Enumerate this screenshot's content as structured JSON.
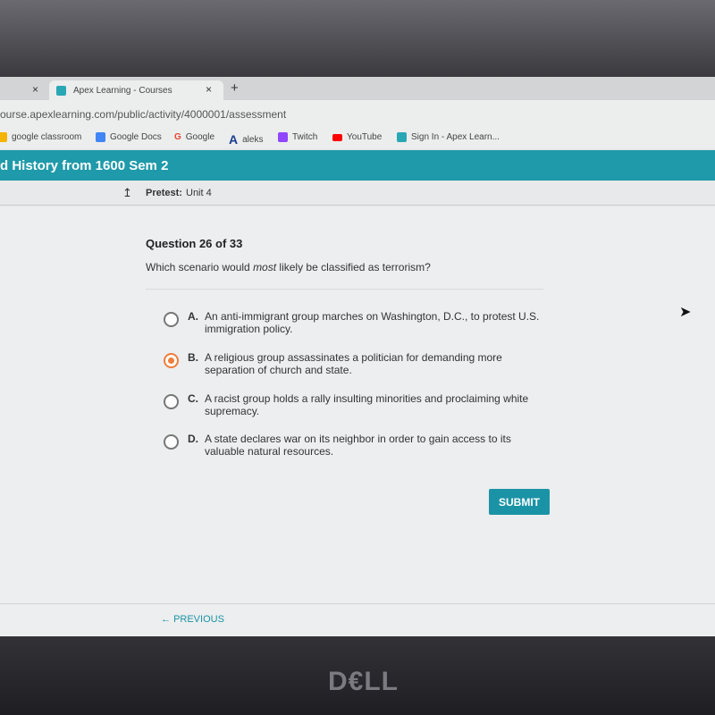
{
  "browser": {
    "tabs": [
      {
        "label": ""
      },
      {
        "label": "Apex Learning - Courses"
      }
    ],
    "new_tab": "+",
    "close": "×",
    "url": "ourse.apexlearning.com/public/activity/4000001/assessment",
    "bookmarks": [
      {
        "label": "google classroom",
        "icon": "classroom-icon",
        "color": "#f4b400"
      },
      {
        "label": "Google Docs",
        "icon": "docs-icon",
        "color": "#4285f4"
      },
      {
        "label": "Google",
        "icon": "google-icon",
        "color": "#ea4335"
      },
      {
        "label": "aleks",
        "icon": "aleks-icon",
        "color": "#1a3d8f"
      },
      {
        "label": "Twitch",
        "icon": "twitch-icon",
        "color": "#9146ff"
      },
      {
        "label": "YouTube",
        "icon": "youtube-icon",
        "color": "#ff0000"
      },
      {
        "label": "Sign In - Apex Learn...",
        "icon": "apex-icon",
        "color": "#2aa7b5"
      }
    ]
  },
  "header": {
    "course": "d History from 1600 Sem 2",
    "color": "#1f9aaa"
  },
  "subheader": {
    "label": "Pretest:",
    "value": "Unit 4"
  },
  "question": {
    "number": "Question 26 of 33",
    "prompt_pre": "Which scenario would ",
    "prompt_em": "most",
    "prompt_post": " likely be classified as terrorism?",
    "options": [
      {
        "letter": "A.",
        "text": "An anti-immigrant group marches on Washington, D.C., to protest U.S. immigration policy.",
        "selected": false
      },
      {
        "letter": "B.",
        "text": "A religious group assassinates a politician for demanding more separation of church and state.",
        "selected": true
      },
      {
        "letter": "C.",
        "text": "A racist group holds a rally insulting minorities and proclaiming white supremacy.",
        "selected": false
      },
      {
        "letter": "D.",
        "text": "A state declares war on its neighbor in order to gain access to its valuable natural resources.",
        "selected": false
      }
    ],
    "submit": "SUBMIT",
    "previous": "PREVIOUS"
  },
  "device": {
    "logo": "DELL"
  }
}
